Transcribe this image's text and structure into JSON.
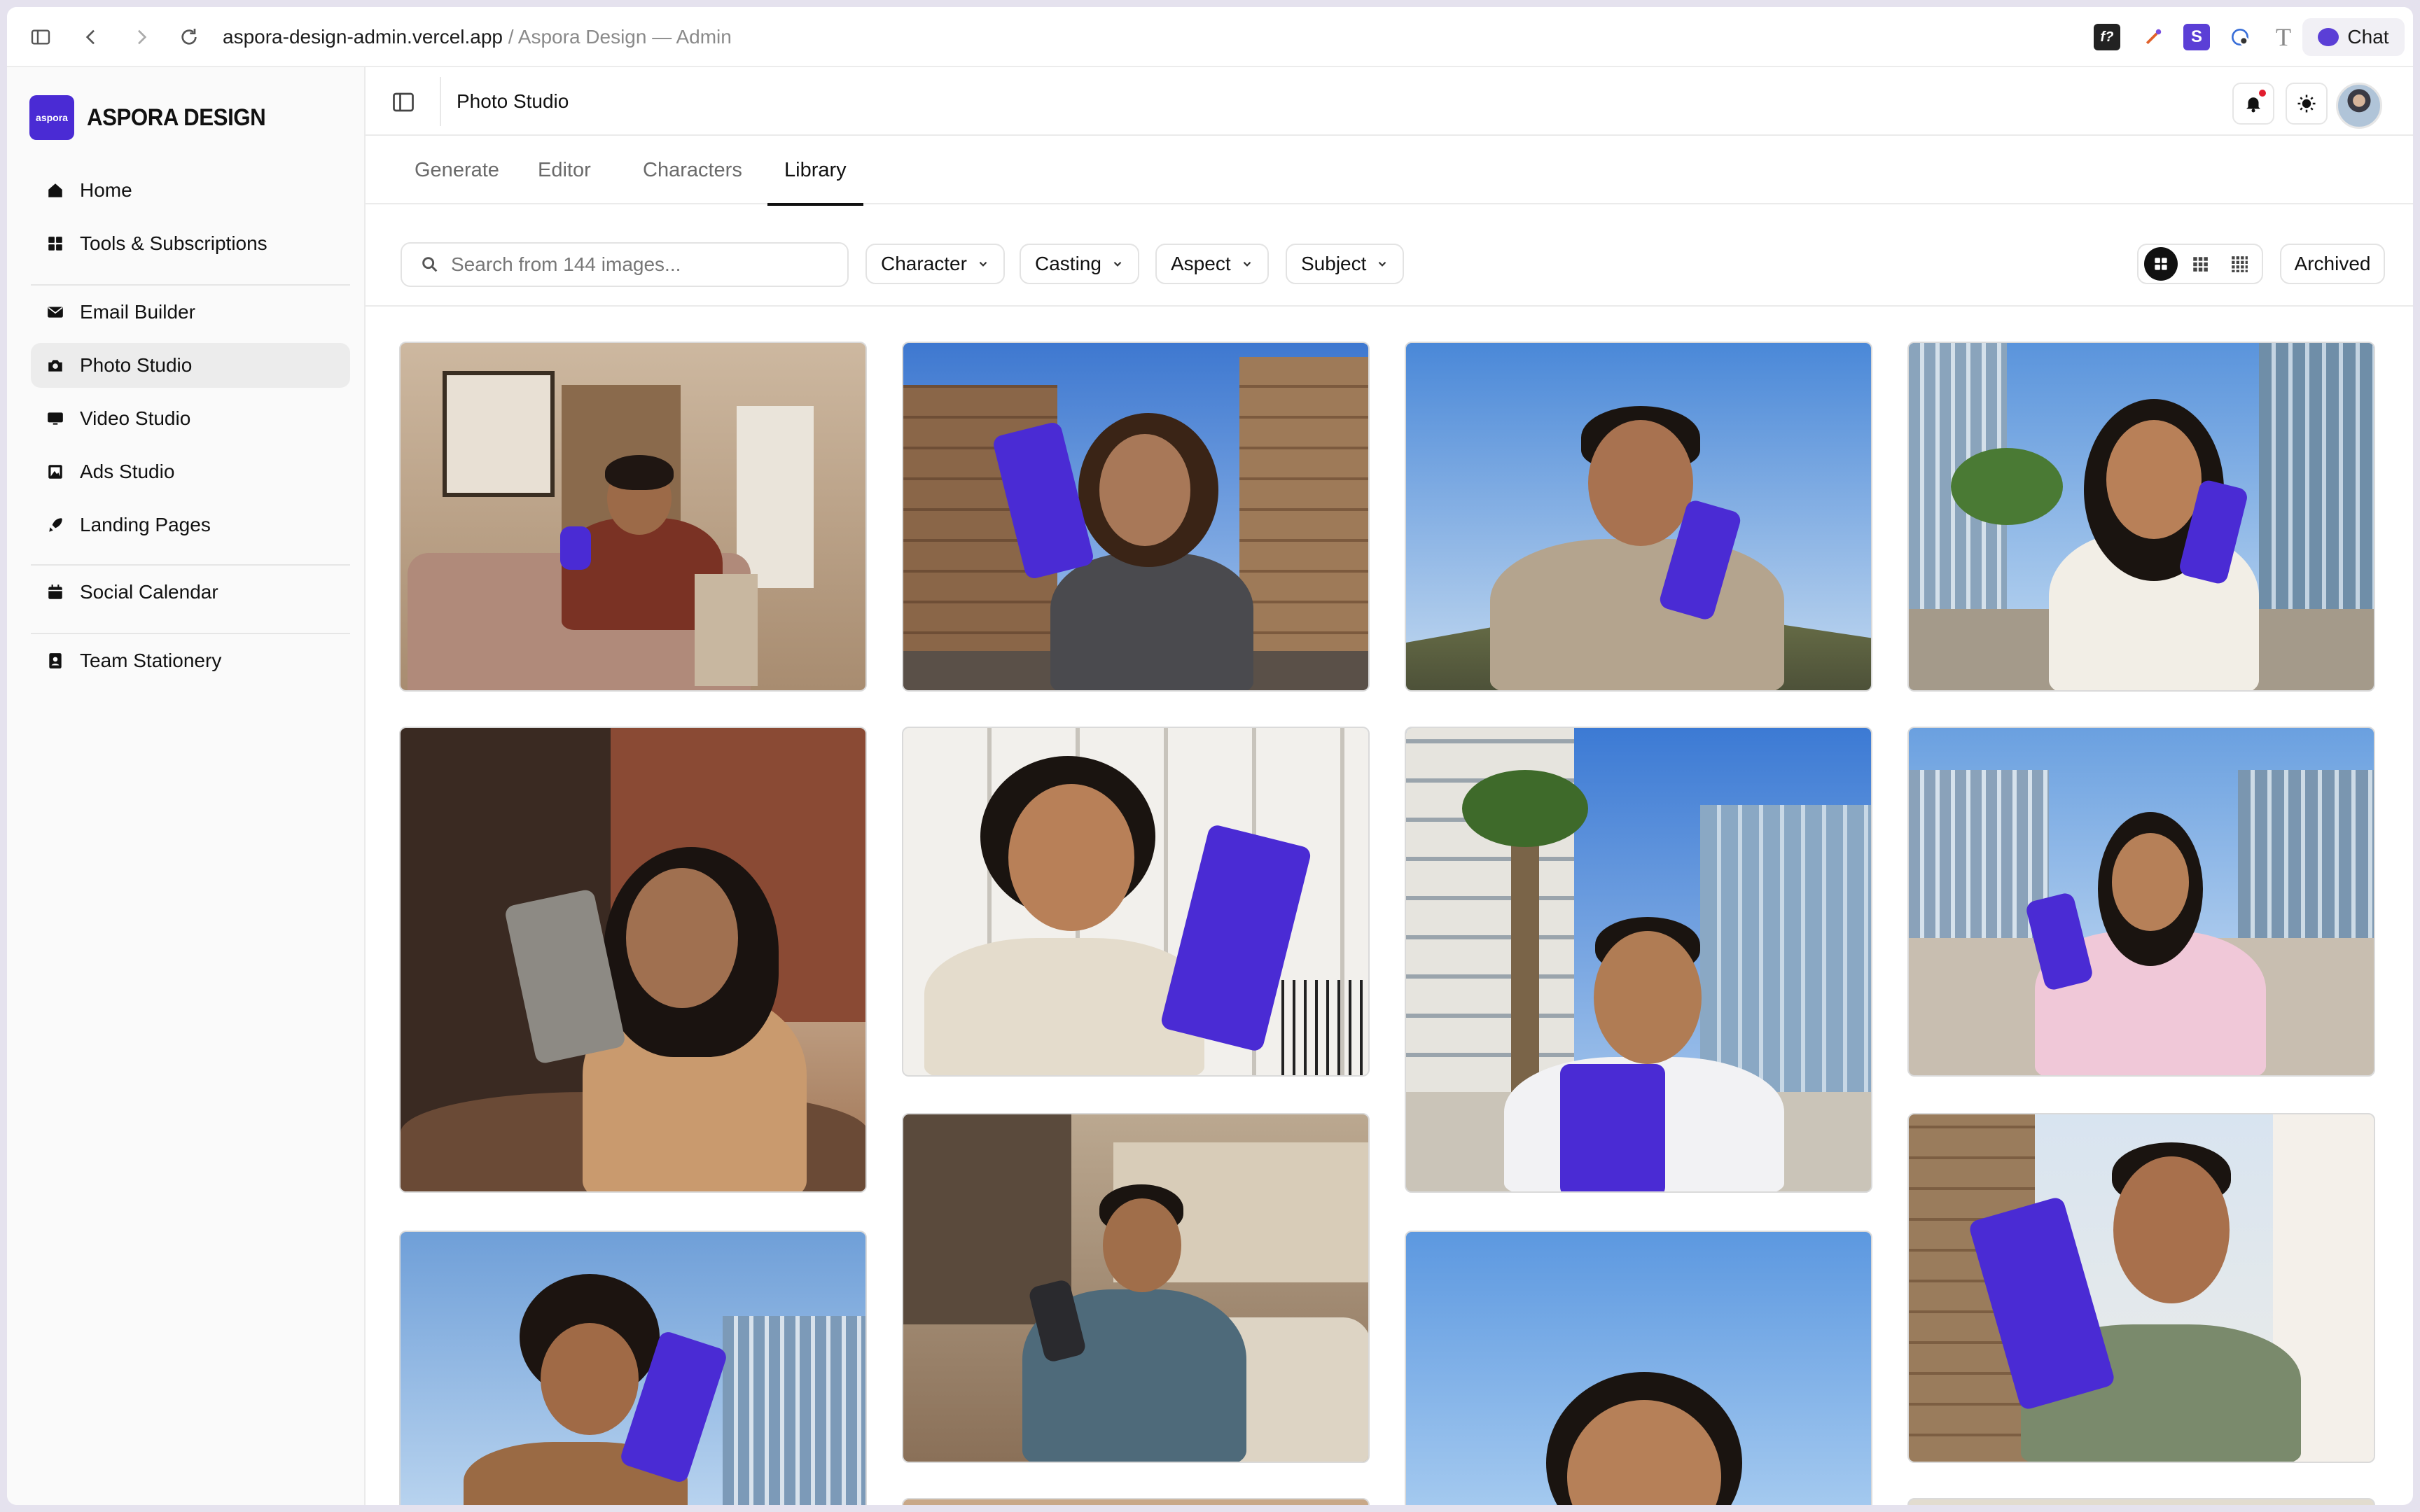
{
  "browser": {
    "url_host": "aspora-design-admin.vercel.app",
    "url_sep": " / ",
    "page_title": "Aspora Design — Admin",
    "chat_label": "Chat"
  },
  "brand": {
    "logo_text": "aspora",
    "name": "ASPORA DESIGN",
    "accent": "#4a2bd4"
  },
  "sidebar": {
    "items": [
      {
        "label": "Home",
        "icon": "home-icon"
      },
      {
        "label": "Tools & Subscriptions",
        "icon": "grid-icon"
      },
      {
        "label": "Email Builder",
        "icon": "mail-icon"
      },
      {
        "label": "Photo Studio",
        "icon": "camera-icon",
        "active": true
      },
      {
        "label": "Video Studio",
        "icon": "monitor-icon"
      },
      {
        "label": "Ads Studio",
        "icon": "image-icon"
      },
      {
        "label": "Landing Pages",
        "icon": "rocket-icon"
      },
      {
        "label": "Social Calendar",
        "icon": "calendar-icon"
      },
      {
        "label": "Team Stationery",
        "icon": "contact-icon"
      }
    ]
  },
  "header": {
    "title": "Photo Studio"
  },
  "tabs": [
    {
      "label": "Generate"
    },
    {
      "label": "Editor"
    },
    {
      "label": "Characters"
    },
    {
      "label": "Library",
      "active": true
    }
  ],
  "filters": {
    "search_placeholder": "Search from 144 images...",
    "dropdowns": [
      {
        "label": "Character"
      },
      {
        "label": "Casting"
      },
      {
        "label": "Aspect"
      },
      {
        "label": "Subject"
      }
    ],
    "archived_label": "Archived"
  },
  "gallery": {
    "images": [
      {
        "subject": "man on sofa in living room with purple phone"
      },
      {
        "subject": "woman taking selfie on london street"
      },
      {
        "subject": "man in sweater against blue sky"
      },
      {
        "subject": "woman at marina with skyscrapers"
      },
      {
        "subject": "woman selfie at cafe with brick building"
      },
      {
        "subject": "woman holding purple phone near white houses"
      },
      {
        "subject": "man with purple phone among palm trees"
      },
      {
        "subject": "woman in pink shirt at marina"
      },
      {
        "subject": "woman in brown coat low-angle selfie"
      },
      {
        "subject": "man on sofa at home with dark phone"
      },
      {
        "subject": "woman against clear blue sky"
      },
      {
        "subject": "man in green polo on london street"
      }
    ]
  }
}
